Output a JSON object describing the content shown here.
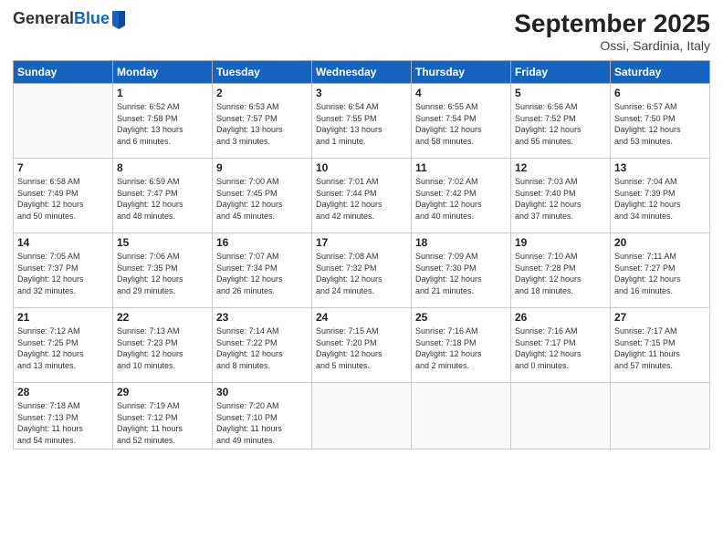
{
  "header": {
    "logo_general": "General",
    "logo_blue": "Blue",
    "month": "September 2025",
    "location": "Ossi, Sardinia, Italy"
  },
  "days_of_week": [
    "Sunday",
    "Monday",
    "Tuesday",
    "Wednesday",
    "Thursday",
    "Friday",
    "Saturday"
  ],
  "weeks": [
    [
      {
        "day": "",
        "info": ""
      },
      {
        "day": "1",
        "info": "Sunrise: 6:52 AM\nSunset: 7:58 PM\nDaylight: 13 hours\nand 6 minutes."
      },
      {
        "day": "2",
        "info": "Sunrise: 6:53 AM\nSunset: 7:57 PM\nDaylight: 13 hours\nand 3 minutes."
      },
      {
        "day": "3",
        "info": "Sunrise: 6:54 AM\nSunset: 7:55 PM\nDaylight: 13 hours\nand 1 minute."
      },
      {
        "day": "4",
        "info": "Sunrise: 6:55 AM\nSunset: 7:54 PM\nDaylight: 12 hours\nand 58 minutes."
      },
      {
        "day": "5",
        "info": "Sunrise: 6:56 AM\nSunset: 7:52 PM\nDaylight: 12 hours\nand 55 minutes."
      },
      {
        "day": "6",
        "info": "Sunrise: 6:57 AM\nSunset: 7:50 PM\nDaylight: 12 hours\nand 53 minutes."
      }
    ],
    [
      {
        "day": "7",
        "info": "Sunrise: 6:58 AM\nSunset: 7:49 PM\nDaylight: 12 hours\nand 50 minutes."
      },
      {
        "day": "8",
        "info": "Sunrise: 6:59 AM\nSunset: 7:47 PM\nDaylight: 12 hours\nand 48 minutes."
      },
      {
        "day": "9",
        "info": "Sunrise: 7:00 AM\nSunset: 7:45 PM\nDaylight: 12 hours\nand 45 minutes."
      },
      {
        "day": "10",
        "info": "Sunrise: 7:01 AM\nSunset: 7:44 PM\nDaylight: 12 hours\nand 42 minutes."
      },
      {
        "day": "11",
        "info": "Sunrise: 7:02 AM\nSunset: 7:42 PM\nDaylight: 12 hours\nand 40 minutes."
      },
      {
        "day": "12",
        "info": "Sunrise: 7:03 AM\nSunset: 7:40 PM\nDaylight: 12 hours\nand 37 minutes."
      },
      {
        "day": "13",
        "info": "Sunrise: 7:04 AM\nSunset: 7:39 PM\nDaylight: 12 hours\nand 34 minutes."
      }
    ],
    [
      {
        "day": "14",
        "info": "Sunrise: 7:05 AM\nSunset: 7:37 PM\nDaylight: 12 hours\nand 32 minutes."
      },
      {
        "day": "15",
        "info": "Sunrise: 7:06 AM\nSunset: 7:35 PM\nDaylight: 12 hours\nand 29 minutes."
      },
      {
        "day": "16",
        "info": "Sunrise: 7:07 AM\nSunset: 7:34 PM\nDaylight: 12 hours\nand 26 minutes."
      },
      {
        "day": "17",
        "info": "Sunrise: 7:08 AM\nSunset: 7:32 PM\nDaylight: 12 hours\nand 24 minutes."
      },
      {
        "day": "18",
        "info": "Sunrise: 7:09 AM\nSunset: 7:30 PM\nDaylight: 12 hours\nand 21 minutes."
      },
      {
        "day": "19",
        "info": "Sunrise: 7:10 AM\nSunset: 7:28 PM\nDaylight: 12 hours\nand 18 minutes."
      },
      {
        "day": "20",
        "info": "Sunrise: 7:11 AM\nSunset: 7:27 PM\nDaylight: 12 hours\nand 16 minutes."
      }
    ],
    [
      {
        "day": "21",
        "info": "Sunrise: 7:12 AM\nSunset: 7:25 PM\nDaylight: 12 hours\nand 13 minutes."
      },
      {
        "day": "22",
        "info": "Sunrise: 7:13 AM\nSunset: 7:23 PM\nDaylight: 12 hours\nand 10 minutes."
      },
      {
        "day": "23",
        "info": "Sunrise: 7:14 AM\nSunset: 7:22 PM\nDaylight: 12 hours\nand 8 minutes."
      },
      {
        "day": "24",
        "info": "Sunrise: 7:15 AM\nSunset: 7:20 PM\nDaylight: 12 hours\nand 5 minutes."
      },
      {
        "day": "25",
        "info": "Sunrise: 7:16 AM\nSunset: 7:18 PM\nDaylight: 12 hours\nand 2 minutes."
      },
      {
        "day": "26",
        "info": "Sunrise: 7:16 AM\nSunset: 7:17 PM\nDaylight: 12 hours\nand 0 minutes."
      },
      {
        "day": "27",
        "info": "Sunrise: 7:17 AM\nSunset: 7:15 PM\nDaylight: 11 hours\nand 57 minutes."
      }
    ],
    [
      {
        "day": "28",
        "info": "Sunrise: 7:18 AM\nSunset: 7:13 PM\nDaylight: 11 hours\nand 54 minutes."
      },
      {
        "day": "29",
        "info": "Sunrise: 7:19 AM\nSunset: 7:12 PM\nDaylight: 11 hours\nand 52 minutes."
      },
      {
        "day": "30",
        "info": "Sunrise: 7:20 AM\nSunset: 7:10 PM\nDaylight: 11 hours\nand 49 minutes."
      },
      {
        "day": "",
        "info": ""
      },
      {
        "day": "",
        "info": ""
      },
      {
        "day": "",
        "info": ""
      },
      {
        "day": "",
        "info": ""
      }
    ]
  ]
}
